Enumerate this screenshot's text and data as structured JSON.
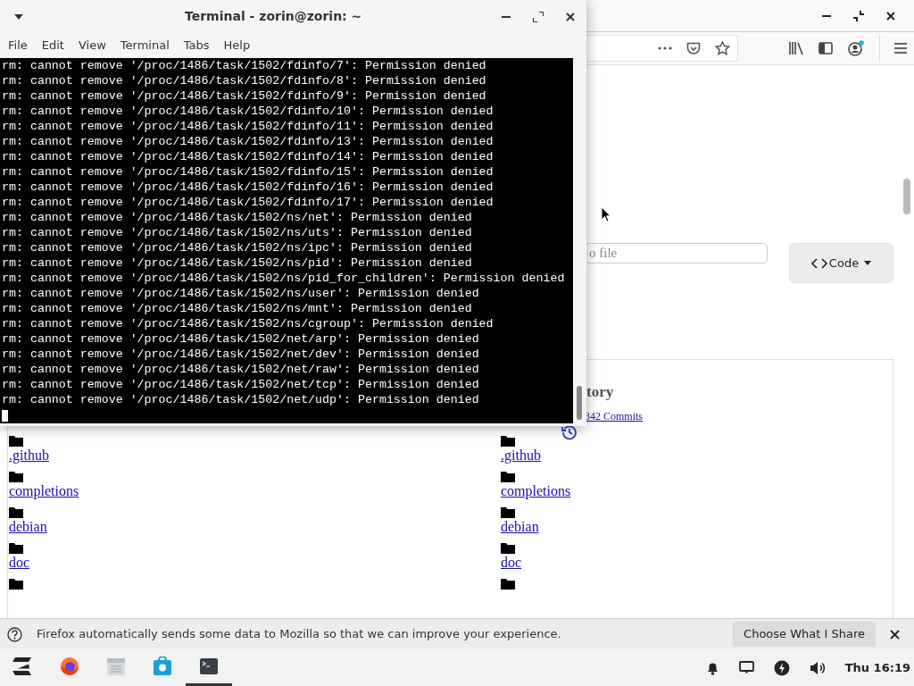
{
  "terminal": {
    "title": "Terminal - zorin@zorin: ~",
    "menu": [
      "File",
      "Edit",
      "View",
      "Terminal",
      "Tabs",
      "Help"
    ],
    "lines": [
      "rm: cannot remove '/proc/1486/task/1502/fdinfo/7': Permission denied",
      "rm: cannot remove '/proc/1486/task/1502/fdinfo/8': Permission denied",
      "rm: cannot remove '/proc/1486/task/1502/fdinfo/9': Permission denied",
      "rm: cannot remove '/proc/1486/task/1502/fdinfo/10': Permission denied",
      "rm: cannot remove '/proc/1486/task/1502/fdinfo/11': Permission denied",
      "rm: cannot remove '/proc/1486/task/1502/fdinfo/13': Permission denied",
      "rm: cannot remove '/proc/1486/task/1502/fdinfo/14': Permission denied",
      "rm: cannot remove '/proc/1486/task/1502/fdinfo/15': Permission denied",
      "rm: cannot remove '/proc/1486/task/1502/fdinfo/16': Permission denied",
      "rm: cannot remove '/proc/1486/task/1502/fdinfo/17': Permission denied",
      "rm: cannot remove '/proc/1486/task/1502/ns/net': Permission denied",
      "rm: cannot remove '/proc/1486/task/1502/ns/uts': Permission denied",
      "rm: cannot remove '/proc/1486/task/1502/ns/ipc': Permission denied",
      "rm: cannot remove '/proc/1486/task/1502/ns/pid': Permission denied",
      "rm: cannot remove '/proc/1486/task/1502/ns/pid_for_children': Permission denied",
      "rm: cannot remove '/proc/1486/task/1502/ns/user': Permission denied",
      "rm: cannot remove '/proc/1486/task/1502/ns/mnt': Permission denied",
      "rm: cannot remove '/proc/1486/task/1502/ns/cgroup': Permission denied",
      "rm: cannot remove '/proc/1486/task/1502/net/arp': Permission denied",
      "rm: cannot remove '/proc/1486/task/1502/net/dev': Permission denied",
      "rm: cannot remove '/proc/1486/task/1502/net/raw': Permission denied",
      "rm: cannot remove '/proc/1486/task/1502/net/tcp': Permission denied",
      "rm: cannot remove '/proc/1486/task/1502/net/udp': Permission denied"
    ]
  },
  "page": {
    "search": {
      "placeholder": "o file"
    },
    "code_button": "Code",
    "history": {
      "heading": "tory",
      "commits": "342 Commits"
    },
    "columns": [
      {
        "items": [
          ".github",
          "completions",
          "debian",
          "doc"
        ]
      },
      {
        "items": [
          ".github",
          "completions",
          "debian",
          "doc"
        ]
      }
    ]
  },
  "notification": {
    "text": "Firefox automatically sends some data to Mozilla so that we can improve your experience.",
    "button": "Choose What I Share"
  },
  "taskbar": {
    "apps": [
      {
        "kind": "zorin",
        "selected": false
      },
      {
        "kind": "firefox",
        "selected": false
      },
      {
        "kind": "files",
        "selected": false
      },
      {
        "kind": "store",
        "selected": false
      },
      {
        "kind": "terminal",
        "selected": true
      }
    ],
    "clock": "Thu 16:19"
  }
}
